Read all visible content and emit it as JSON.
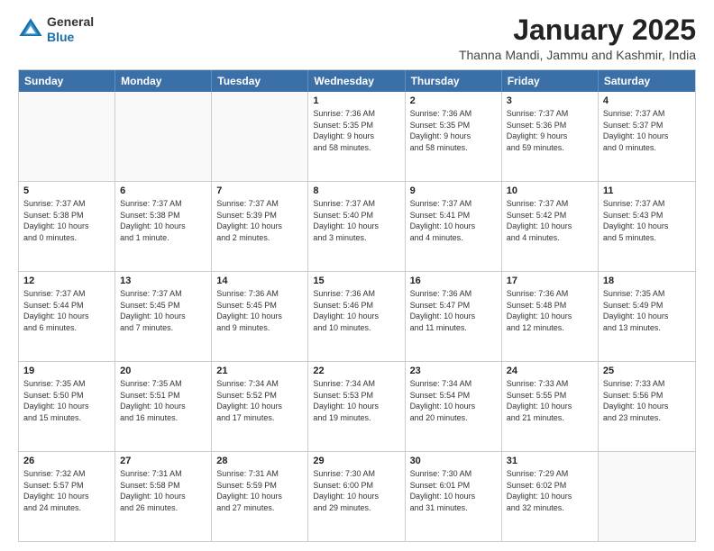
{
  "logo": {
    "general": "General",
    "blue": "Blue"
  },
  "header": {
    "month": "January 2025",
    "location": "Thanna Mandi, Jammu and Kashmir, India"
  },
  "weekdays": [
    "Sunday",
    "Monday",
    "Tuesday",
    "Wednesday",
    "Thursday",
    "Friday",
    "Saturday"
  ],
  "rows": [
    [
      {
        "day": "",
        "text": "",
        "empty": true
      },
      {
        "day": "",
        "text": "",
        "empty": true
      },
      {
        "day": "",
        "text": "",
        "empty": true
      },
      {
        "day": "1",
        "text": "Sunrise: 7:36 AM\nSunset: 5:35 PM\nDaylight: 9 hours\nand 58 minutes."
      },
      {
        "day": "2",
        "text": "Sunrise: 7:36 AM\nSunset: 5:35 PM\nDaylight: 9 hours\nand 58 minutes."
      },
      {
        "day": "3",
        "text": "Sunrise: 7:37 AM\nSunset: 5:36 PM\nDaylight: 9 hours\nand 59 minutes."
      },
      {
        "day": "4",
        "text": "Sunrise: 7:37 AM\nSunset: 5:37 PM\nDaylight: 10 hours\nand 0 minutes."
      }
    ],
    [
      {
        "day": "5",
        "text": "Sunrise: 7:37 AM\nSunset: 5:38 PM\nDaylight: 10 hours\nand 0 minutes."
      },
      {
        "day": "6",
        "text": "Sunrise: 7:37 AM\nSunset: 5:38 PM\nDaylight: 10 hours\nand 1 minute."
      },
      {
        "day": "7",
        "text": "Sunrise: 7:37 AM\nSunset: 5:39 PM\nDaylight: 10 hours\nand 2 minutes."
      },
      {
        "day": "8",
        "text": "Sunrise: 7:37 AM\nSunset: 5:40 PM\nDaylight: 10 hours\nand 3 minutes."
      },
      {
        "day": "9",
        "text": "Sunrise: 7:37 AM\nSunset: 5:41 PM\nDaylight: 10 hours\nand 4 minutes."
      },
      {
        "day": "10",
        "text": "Sunrise: 7:37 AM\nSunset: 5:42 PM\nDaylight: 10 hours\nand 4 minutes."
      },
      {
        "day": "11",
        "text": "Sunrise: 7:37 AM\nSunset: 5:43 PM\nDaylight: 10 hours\nand 5 minutes."
      }
    ],
    [
      {
        "day": "12",
        "text": "Sunrise: 7:37 AM\nSunset: 5:44 PM\nDaylight: 10 hours\nand 6 minutes."
      },
      {
        "day": "13",
        "text": "Sunrise: 7:37 AM\nSunset: 5:45 PM\nDaylight: 10 hours\nand 7 minutes."
      },
      {
        "day": "14",
        "text": "Sunrise: 7:36 AM\nSunset: 5:45 PM\nDaylight: 10 hours\nand 9 minutes."
      },
      {
        "day": "15",
        "text": "Sunrise: 7:36 AM\nSunset: 5:46 PM\nDaylight: 10 hours\nand 10 minutes."
      },
      {
        "day": "16",
        "text": "Sunrise: 7:36 AM\nSunset: 5:47 PM\nDaylight: 10 hours\nand 11 minutes."
      },
      {
        "day": "17",
        "text": "Sunrise: 7:36 AM\nSunset: 5:48 PM\nDaylight: 10 hours\nand 12 minutes."
      },
      {
        "day": "18",
        "text": "Sunrise: 7:35 AM\nSunset: 5:49 PM\nDaylight: 10 hours\nand 13 minutes."
      }
    ],
    [
      {
        "day": "19",
        "text": "Sunrise: 7:35 AM\nSunset: 5:50 PM\nDaylight: 10 hours\nand 15 minutes."
      },
      {
        "day": "20",
        "text": "Sunrise: 7:35 AM\nSunset: 5:51 PM\nDaylight: 10 hours\nand 16 minutes."
      },
      {
        "day": "21",
        "text": "Sunrise: 7:34 AM\nSunset: 5:52 PM\nDaylight: 10 hours\nand 17 minutes."
      },
      {
        "day": "22",
        "text": "Sunrise: 7:34 AM\nSunset: 5:53 PM\nDaylight: 10 hours\nand 19 minutes."
      },
      {
        "day": "23",
        "text": "Sunrise: 7:34 AM\nSunset: 5:54 PM\nDaylight: 10 hours\nand 20 minutes."
      },
      {
        "day": "24",
        "text": "Sunrise: 7:33 AM\nSunset: 5:55 PM\nDaylight: 10 hours\nand 21 minutes."
      },
      {
        "day": "25",
        "text": "Sunrise: 7:33 AM\nSunset: 5:56 PM\nDaylight: 10 hours\nand 23 minutes."
      }
    ],
    [
      {
        "day": "26",
        "text": "Sunrise: 7:32 AM\nSunset: 5:57 PM\nDaylight: 10 hours\nand 24 minutes."
      },
      {
        "day": "27",
        "text": "Sunrise: 7:31 AM\nSunset: 5:58 PM\nDaylight: 10 hours\nand 26 minutes."
      },
      {
        "day": "28",
        "text": "Sunrise: 7:31 AM\nSunset: 5:59 PM\nDaylight: 10 hours\nand 27 minutes."
      },
      {
        "day": "29",
        "text": "Sunrise: 7:30 AM\nSunset: 6:00 PM\nDaylight: 10 hours\nand 29 minutes."
      },
      {
        "day": "30",
        "text": "Sunrise: 7:30 AM\nSunset: 6:01 PM\nDaylight: 10 hours\nand 31 minutes."
      },
      {
        "day": "31",
        "text": "Sunrise: 7:29 AM\nSunset: 6:02 PM\nDaylight: 10 hours\nand 32 minutes."
      },
      {
        "day": "",
        "text": "",
        "empty": true
      }
    ]
  ]
}
